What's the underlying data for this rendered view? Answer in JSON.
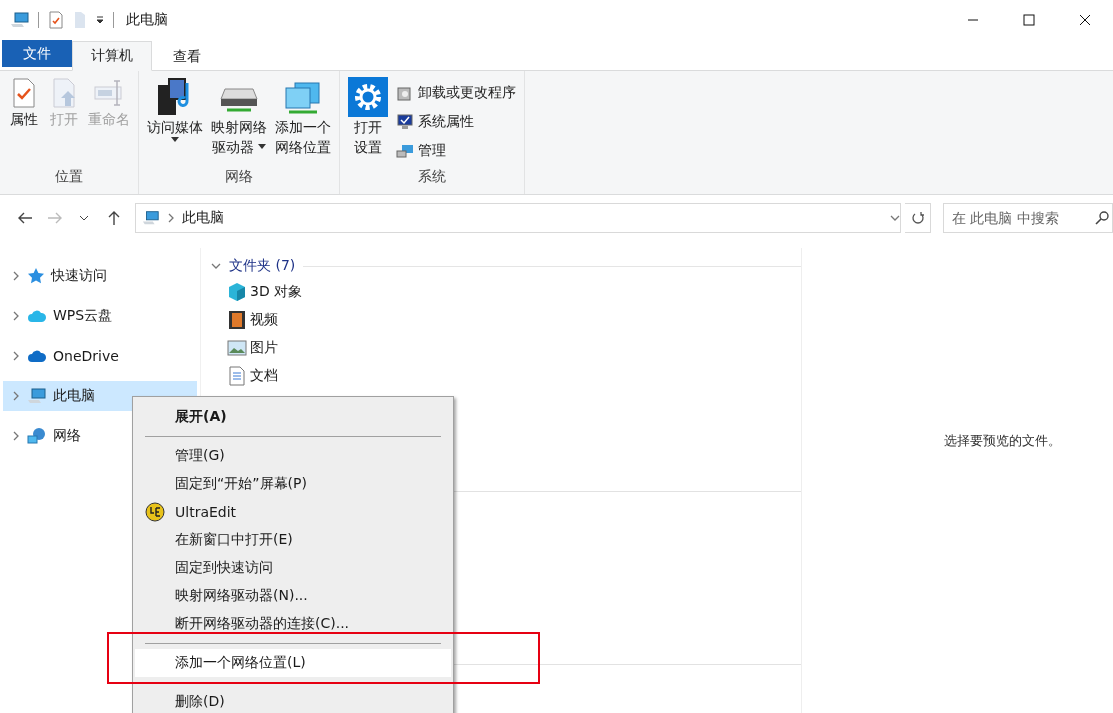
{
  "window": {
    "title": "此电脑"
  },
  "tabs": [
    {
      "label": "文件",
      "kind": "file",
      "selected": false
    },
    {
      "label": "计算机",
      "kind": "tab",
      "selected": true
    },
    {
      "label": "查看",
      "kind": "tab",
      "selected": false
    }
  ],
  "ribbon": {
    "groups": [
      {
        "label": "位置",
        "buttons": [
          {
            "kind": "large",
            "lines": [
              "属性"
            ],
            "disabled": false,
            "dropdown": false
          },
          {
            "kind": "large",
            "lines": [
              "打开"
            ],
            "disabled": true,
            "dropdown": false
          },
          {
            "kind": "large",
            "lines": [
              "重命名"
            ],
            "disabled": true,
            "dropdown": false
          }
        ]
      },
      {
        "label": "网络",
        "buttons": [
          {
            "kind": "large",
            "lines": [
              "访问媒体"
            ],
            "disabled": false,
            "dropdown": true
          },
          {
            "kind": "large",
            "lines": [
              "映射网络",
              "驱动器"
            ],
            "disabled": false,
            "dropdown": true
          },
          {
            "kind": "large",
            "lines": [
              "添加一个",
              "网络位置"
            ],
            "disabled": false,
            "dropdown": false
          }
        ]
      },
      {
        "label": "系统",
        "buttons": [
          {
            "kind": "large",
            "lines": [
              "打开",
              "设置"
            ],
            "disabled": false,
            "dropdown": false
          },
          {
            "kind": "small",
            "lines": [
              "卸载或更改程序"
            ]
          },
          {
            "kind": "small",
            "lines": [
              "系统属性"
            ]
          },
          {
            "kind": "small",
            "lines": [
              "管理"
            ]
          }
        ]
      }
    ]
  },
  "address": {
    "path": "此电脑",
    "search_placeholder": "在 此电脑 中搜索"
  },
  "sidebar": {
    "items": [
      {
        "label": "快速访问",
        "selected": false
      },
      {
        "label": "WPS云盘",
        "selected": false
      },
      {
        "label": "OneDrive",
        "selected": false
      },
      {
        "label": "此电脑",
        "selected": true
      },
      {
        "label": "网络",
        "selected": false
      }
    ]
  },
  "content": {
    "group": {
      "label": "文件夹 (7)",
      "expanded": true
    },
    "folders": [
      {
        "label": "3D 对象"
      },
      {
        "label": "视频"
      },
      {
        "label": "图片"
      },
      {
        "label": "文档"
      }
    ]
  },
  "preview": {
    "message": "选择要预览的文件。"
  },
  "context_menu": {
    "items": [
      {
        "kind": "default",
        "label": "展开(A)",
        "selected": false
      },
      {
        "kind": "separator"
      },
      {
        "kind": "command",
        "label": "管理(G)",
        "selected": false
      },
      {
        "kind": "command",
        "label": "固定到“开始”屏幕(P)",
        "selected": false
      },
      {
        "kind": "app",
        "label": "UltraEdit",
        "selected": false
      },
      {
        "kind": "command",
        "label": "在新窗口中打开(E)",
        "selected": false
      },
      {
        "kind": "command",
        "label": "固定到快速访问",
        "selected": false
      },
      {
        "kind": "command",
        "label": "映射网络驱动器(N)...",
        "selected": false
      },
      {
        "kind": "command",
        "label": "断开网络驱动器的连接(C)...",
        "selected": false
      },
      {
        "kind": "separator"
      },
      {
        "kind": "command",
        "label": "添加一个网络位置(L)",
        "selected": true
      },
      {
        "kind": "separator"
      },
      {
        "kind": "command",
        "label": "删除(D)",
        "selected": false
      }
    ]
  }
}
